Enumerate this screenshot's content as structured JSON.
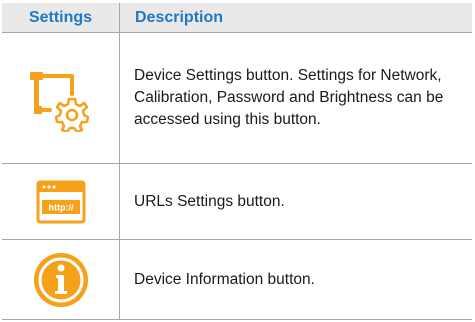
{
  "table": {
    "headers": {
      "settings": "Settings",
      "description": "Description"
    },
    "rows": [
      {
        "icon": "device-settings-icon",
        "description": "Device Settings button. Settings for Network, Calibration, Password and Brightness can be accessed using this button."
      },
      {
        "icon": "urls-settings-icon",
        "icon_text": "http://",
        "description": "URLs Settings button."
      },
      {
        "icon": "info-icon",
        "description": "Device Information button."
      }
    ]
  },
  "colors": {
    "header_text": "#1f78c1",
    "header_bg": "#e9e9e9",
    "icon_accent": "#f5a21a",
    "border": "#a8a8a8"
  }
}
